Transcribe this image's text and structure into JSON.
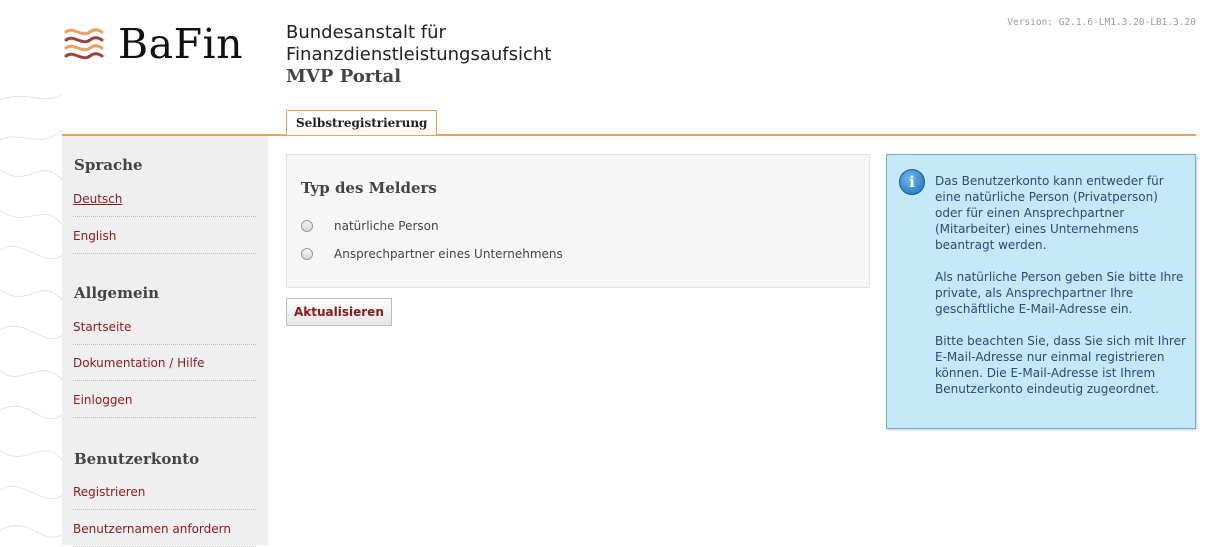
{
  "header": {
    "version": "Version: G2.1.6-LM1.3.20-LB1.3.20",
    "logo_text": "BaFin",
    "institution_line1": "Bundesanstalt für",
    "institution_line2": "Finanzdienstleistungsaufsicht",
    "portal_name": "MVP Portal"
  },
  "tabs": [
    {
      "label": "Selbstregistrierung",
      "active": true
    }
  ],
  "sidebar": {
    "sections": [
      {
        "heading": "Sprache",
        "items": [
          {
            "label": "Deutsch",
            "active": true
          },
          {
            "label": "English"
          }
        ]
      },
      {
        "heading": "Allgemein",
        "items": [
          {
            "label": "Startseite"
          },
          {
            "label": "Dokumentation / Hilfe"
          },
          {
            "label": "Einloggen"
          }
        ]
      },
      {
        "heading": "Benutzerkonto",
        "items": [
          {
            "label": "Registrieren"
          },
          {
            "label": "Benutzernamen anfordern"
          }
        ]
      }
    ]
  },
  "form": {
    "title": "Typ des Melders",
    "options": [
      {
        "label": "natürliche Person",
        "selected": false
      },
      {
        "label": "Ansprechpartner eines Unternehmens",
        "selected": false
      }
    ],
    "submit_label": "Aktualisieren"
  },
  "info": {
    "icon": "info-icon",
    "paragraphs": [
      "Das Benutzerkonto kann entweder für eine natürliche Person (Privatperson) oder für einen Ansprechpartner (Mitarbeiter) eines Unternehmens beantragt werden.",
      "Als natürliche Person geben Sie bitte Ihre private, als Ansprechpartner Ihre geschäftliche E-Mail-Adresse ein.",
      "Bitte beachten Sie, dass Sie sich mit Ihrer E-Mail-Adresse nur einmal registrieren können. Die E-Mail-Adresse ist Ihrem Benutzerkonto eindeutig zugeordnet."
    ]
  },
  "colors": {
    "accent": "#e8a25f",
    "link": "#8b1a1a",
    "info_bg": "#c6e9f9",
    "sidebar_bg": "#efefef"
  }
}
